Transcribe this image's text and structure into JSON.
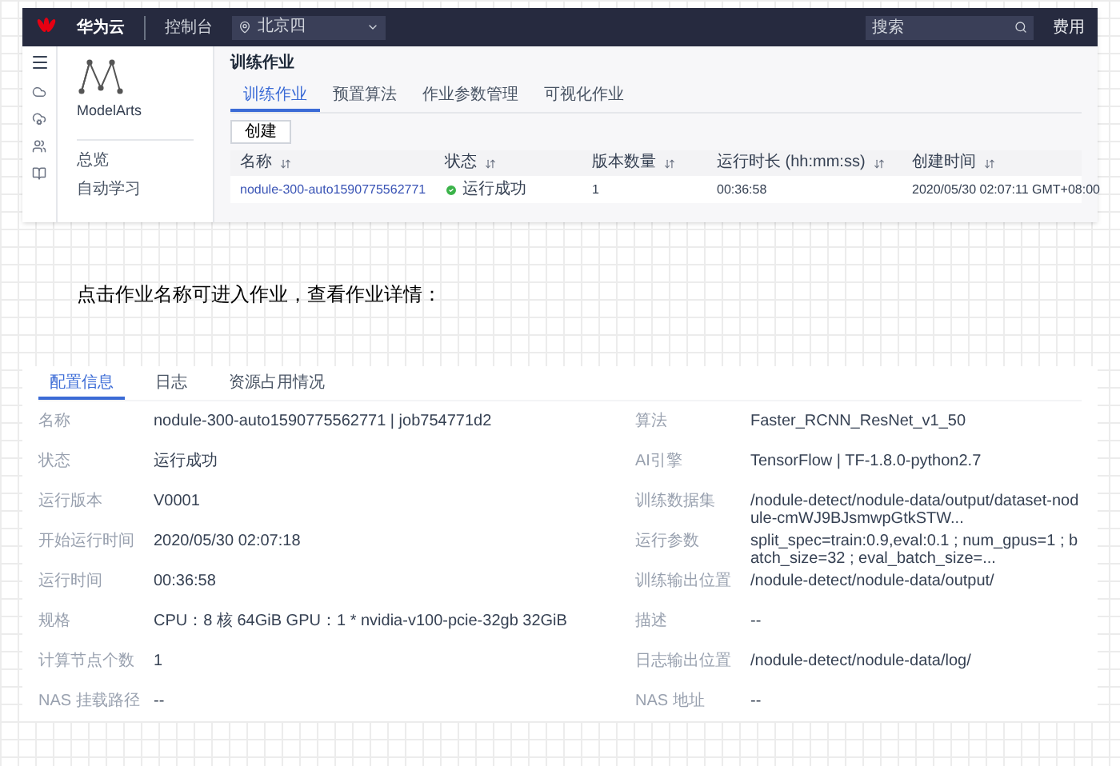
{
  "console": {
    "header": {
      "brand": "华为云",
      "console": "控制台",
      "region": "北京四",
      "search": {
        "placeholder": "搜索"
      },
      "link": "费用"
    },
    "sidebar": {
      "product": "ModelArts",
      "items": [
        "总览",
        "自动学习"
      ]
    },
    "page_title": "训练作业",
    "tabs": [
      {
        "label": "训练作业",
        "selected": true
      },
      {
        "label": "预置算法",
        "selected": false
      },
      {
        "label": "作业参数管理",
        "selected": false
      },
      {
        "label": "可视化作业",
        "selected": false
      }
    ],
    "create_button": "创建",
    "table": {
      "columns": [
        "名称",
        "状态",
        "版本数量",
        "运行时长 (hh:mm:ss)",
        "创建时间"
      ],
      "rows": [
        {
          "name": "nodule-300-auto1590775562771",
          "status": "运行成功",
          "color": "#3bb34a",
          "versions": "1",
          "duration": "00:36:58",
          "created": "2020/05/30 02:07:11 GMT+08:00"
        }
      ]
    }
  },
  "note": "点击作业名称可进入作业，查看作业详情：",
  "detail": {
    "tabs": [
      {
        "label": "配置信息",
        "selected": true
      },
      {
        "label": "日志",
        "selected": false
      },
      {
        "label": "资源占用情况",
        "selected": false
      }
    ],
    "left": [
      {
        "label": "名称",
        "value": "nodule-300-auto1590775562771 | job754771d2"
      },
      {
        "label": "状态",
        "value": "运行成功"
      },
      {
        "label": "运行版本",
        "value": "V0001"
      },
      {
        "label": "开始运行时间",
        "value": "2020/05/30 02:07:18"
      },
      {
        "label": "运行时间",
        "value": "00:36:58"
      },
      {
        "label": "规格",
        "value": "CPU：8 核 64GiB GPU：1 * nvidia-v100-pcie-32gb 32GiB"
      },
      {
        "label": "计算节点个数",
        "value": "1"
      },
      {
        "label": "NAS 挂载路径",
        "value": "--"
      }
    ],
    "right": [
      {
        "label": "算法",
        "value": "Faster_RCNN_ResNet_v1_50"
      },
      {
        "label": "AI引擎",
        "value": "TensorFlow | TF-1.8.0-python2.7"
      },
      {
        "label": "训练数据集",
        "value": "/nodule-detect/nodule-data/output/dataset-nodule-cmWJ9BJsmwpGtkSTW..."
      },
      {
        "label": "运行参数",
        "value": "split_spec=train:0.9,eval:0.1 ; num_gpus=1 ; batch_size=32 ; eval_batch_size=..."
      },
      {
        "label": "训练输出位置",
        "value": "/nodule-detect/nodule-data/output/"
      },
      {
        "label": "描述",
        "value": "--"
      },
      {
        "label": "日志输出位置",
        "value": "/nodule-detect/nodule-data/log/"
      },
      {
        "label": "NAS 地址",
        "value": "--"
      }
    ]
  }
}
